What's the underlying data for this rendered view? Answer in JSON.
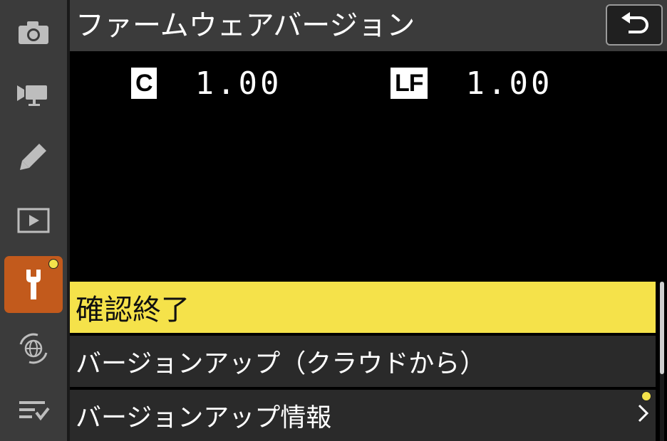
{
  "sidebar": {
    "items": [
      {
        "icon": "camera-icon"
      },
      {
        "icon": "movie-camera-icon"
      },
      {
        "icon": "pencil-icon"
      },
      {
        "icon": "playback-icon"
      },
      {
        "icon": "wrench-icon",
        "active": true
      },
      {
        "icon": "network-icon"
      },
      {
        "icon": "my-menu-icon"
      }
    ]
  },
  "header": {
    "title": "ファームウェアバージョン",
    "back_icon": "return-icon"
  },
  "firmware": [
    {
      "badge": "C",
      "version": "1.00"
    },
    {
      "badge": "LF",
      "version": "1.00"
    }
  ],
  "menu": {
    "items": [
      {
        "label": "確認終了"
      },
      {
        "label": "バージョンアップ（クラウドから）"
      },
      {
        "label": "バージョンアップ情報"
      }
    ]
  },
  "colors": {
    "accent_selected": "#f5e24a",
    "active_tab": "#c25a1c",
    "notification_dot": "#f3e24b"
  }
}
